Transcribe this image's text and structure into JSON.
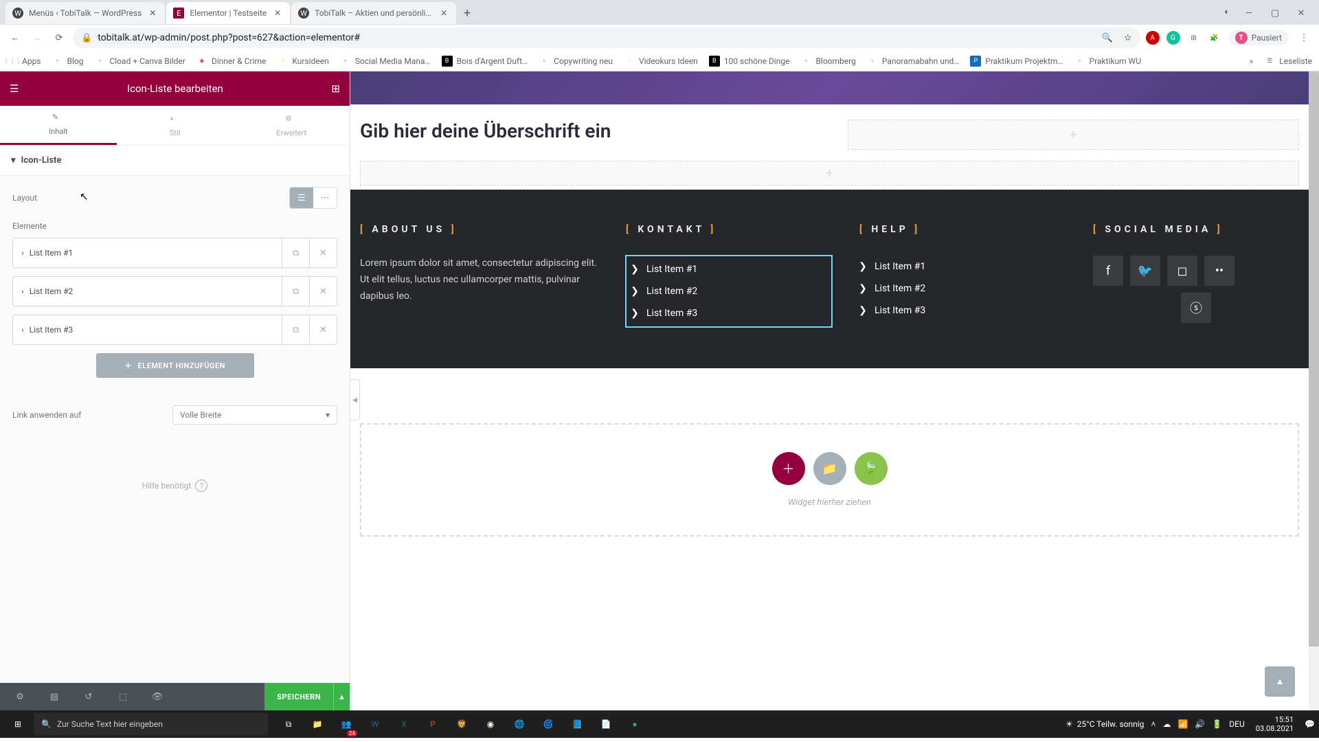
{
  "browser": {
    "tabs": [
      {
        "favicon": "W",
        "title": "Menüs ‹ TobiTalk — WordPress"
      },
      {
        "favicon": "E",
        "title": "Elementor | Testseite"
      },
      {
        "favicon": "W",
        "title": "TobiTalk – Aktien und persönlich…"
      }
    ],
    "url": "tobitalk.at/wp-admin/post.php?post=627&action=elementor#",
    "paused_label": "Pausiert",
    "bookmarks": [
      {
        "icon": "⋮⋮⋮",
        "label": "Apps",
        "color": "#5f6368"
      },
      {
        "icon": "■",
        "label": "Blog",
        "color": "#888"
      },
      {
        "icon": "●",
        "label": "Cload + Canva Bilder",
        "color": "#888"
      },
      {
        "icon": "D",
        "label": "Dinner & Crime",
        "color": "#c66"
      },
      {
        "icon": "●",
        "label": "Kursideen",
        "color": "#fbbc04"
      },
      {
        "icon": "■",
        "label": "Social Media Mana…",
        "color": "#888"
      },
      {
        "icon": "B",
        "label": "Bois d'Argent Duft…",
        "color": "#000"
      },
      {
        "icon": "■",
        "label": "Copywriting neu",
        "color": "#888"
      },
      {
        "icon": "■",
        "label": "Videokurs Ideen",
        "color": "#fbbc04"
      },
      {
        "icon": "B",
        "label": "100 schöne Dinge",
        "color": "#000"
      },
      {
        "icon": "■",
        "label": "Bloomberg",
        "color": "#888"
      },
      {
        "icon": "■",
        "label": "Panoramabahn und…",
        "color": "#888"
      },
      {
        "icon": "P",
        "label": "Praktikum Projektm…",
        "color": "#0f6cbf"
      },
      {
        "icon": "■",
        "label": "Praktikum WU",
        "color": "#888"
      }
    ],
    "reading_list": "Leseliste"
  },
  "panel": {
    "title": "Icon-Liste bearbeiten",
    "tabs": {
      "content": "Inhalt",
      "style": "Stil",
      "advanced": "Erweitert"
    },
    "section": "Icon-Liste",
    "layout_label": "Layout",
    "elements_label": "Elemente",
    "items": [
      {
        "label": "List Item #1"
      },
      {
        "label": "List Item #2"
      },
      {
        "label": "List Item #3"
      }
    ],
    "add_item": "ELEMENT HINZUFÜGEN",
    "link_apply_label": "Link anwenden auf",
    "link_apply_value": "Volle Breite",
    "help": "Hilfe benötigt",
    "save": "SPEICHERN"
  },
  "canvas": {
    "heading": "Gib hier deine Überschrift ein",
    "footer": {
      "about": {
        "heading": "ABOUT US",
        "body": "Lorem ipsum dolor sit amet, consectetur adipiscing elit. Ut elit tellus, luctus nec ullamcorper mattis, pulvinar dapibus leo."
      },
      "contact": {
        "heading": "KONTAKT",
        "items": [
          "List Item #1",
          "List Item #2",
          "List Item #3"
        ]
      },
      "help": {
        "heading": "HELP",
        "items": [
          "List Item #1",
          "List Item #2",
          "List Item #3"
        ]
      },
      "social": {
        "heading": "SOCIAL MEDIA"
      }
    },
    "drop_text": "Widget hierher ziehen"
  },
  "taskbar": {
    "search_placeholder": "Zur Suche Text hier eingeben",
    "weather": "25°C  Teilw. sonnig",
    "lang": "DEU",
    "time": "15:51",
    "date": "03.08.2021",
    "teams_badge": "24"
  }
}
